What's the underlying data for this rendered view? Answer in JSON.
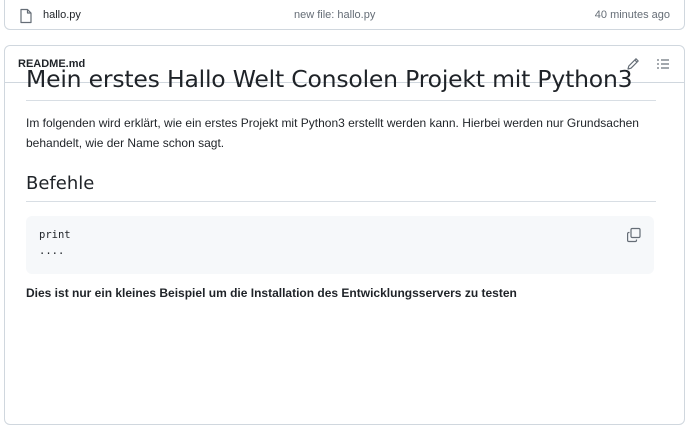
{
  "file_row": {
    "icon": "file-icon",
    "name": "hallo.py",
    "commit_message": "new file: hallo.py",
    "time": "40 minutes ago"
  },
  "readme": {
    "filename": "README.md",
    "edit_icon": "pencil-icon",
    "toc_icon": "list-icon",
    "heading": "Mein erstes Hallo Welt Consolen Projekt mit Python3",
    "intro": "Im folgenden wird erklärt, wie ein erstes Projekt mit Python3 erstellt werden kann. Hierbei werden nur Grundsachen behandelt, wie der Name schon sagt.",
    "section_heading": "Befehle",
    "code_lines": [
      "print",
      "...."
    ],
    "copy_icon": "copy-icon",
    "bold_text": "Dies ist nur ein kleines Beispiel um die Installation des Entwicklungsservers zu testen"
  },
  "colors": {
    "border": "#d0d7de",
    "muted_text": "#656d76",
    "code_bg": "#f6f8fa",
    "text": "#1f2328"
  }
}
